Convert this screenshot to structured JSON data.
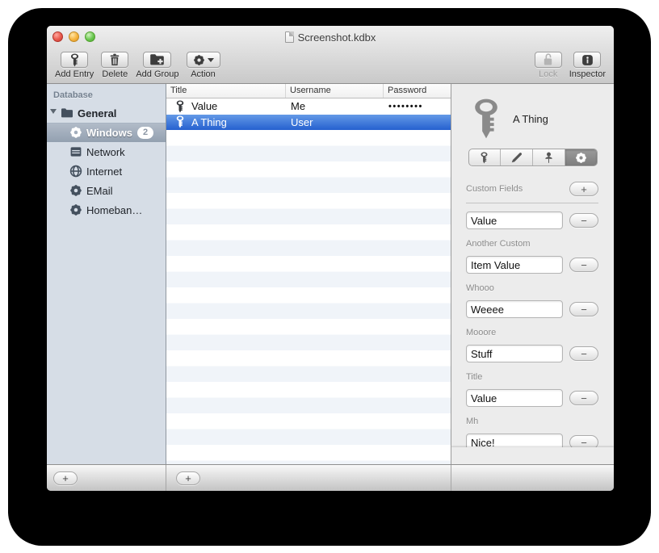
{
  "window": {
    "title": "Screenshot.kdbx"
  },
  "toolbar": {
    "add_entry": {
      "label": "Add Entry",
      "icon": "key-icon"
    },
    "delete": {
      "label": "Delete",
      "icon": "trash-icon"
    },
    "add_group": {
      "label": "Add Group",
      "icon": "folder-plus-icon"
    },
    "action": {
      "label": "Action",
      "icon": "gear-icon"
    },
    "lock": {
      "label": "Lock",
      "icon": "padlock-open-icon",
      "disabled": true
    },
    "inspector": {
      "label": "Inspector",
      "icon": "info-icon"
    }
  },
  "sidebar": {
    "header": "Database",
    "root": {
      "label": "General",
      "icon": "folder-icon"
    },
    "items": [
      {
        "label": "Windows",
        "badge": "2",
        "icon": "gear-icon",
        "selected": true
      },
      {
        "label": "Network",
        "badge": "",
        "icon": "server-icon",
        "selected": false
      },
      {
        "label": "Internet",
        "badge": "",
        "icon": "globe-icon",
        "selected": false
      },
      {
        "label": "EMail",
        "badge": "",
        "icon": "gear-icon",
        "selected": false
      },
      {
        "label": "Homeban…",
        "badge": "",
        "icon": "gear-icon",
        "selected": false
      }
    ],
    "add_button": "+"
  },
  "table": {
    "columns": [
      "Title",
      "Username",
      "Password"
    ],
    "rows": [
      {
        "title": "Value",
        "username": "Me",
        "password": "••••••••",
        "selected": false
      },
      {
        "title": "A Thing",
        "username": "User",
        "password": "",
        "selected": true
      }
    ],
    "add_button": "+"
  },
  "inspector": {
    "entry_title": "A Thing",
    "entry_icon": "key-icon",
    "tabs": [
      "key-icon",
      "pencil-icon",
      "pushpin-icon",
      "gear-icon"
    ],
    "selected_tab": "gear-icon",
    "custom_fields": {
      "header": "Custom Fields",
      "add_label": "+",
      "remove_label": "−",
      "items": [
        {
          "label": "",
          "value": "Value"
        },
        {
          "label": "Another Custom",
          "value": "Item Value"
        },
        {
          "label": "Whooo",
          "value": "Weeee"
        },
        {
          "label": "Mooore",
          "value": "Stuff"
        },
        {
          "label": "Title",
          "value": "Value"
        },
        {
          "label": "Mh",
          "value": "Nice!"
        }
      ]
    }
  },
  "colors": {
    "selection_blue_top": "#6499e7",
    "selection_blue_bottom": "#2560cf",
    "sidebar_bg": "#d6dde6",
    "inspector_bg": "#ececec",
    "stripe": "#f0f4f9"
  }
}
